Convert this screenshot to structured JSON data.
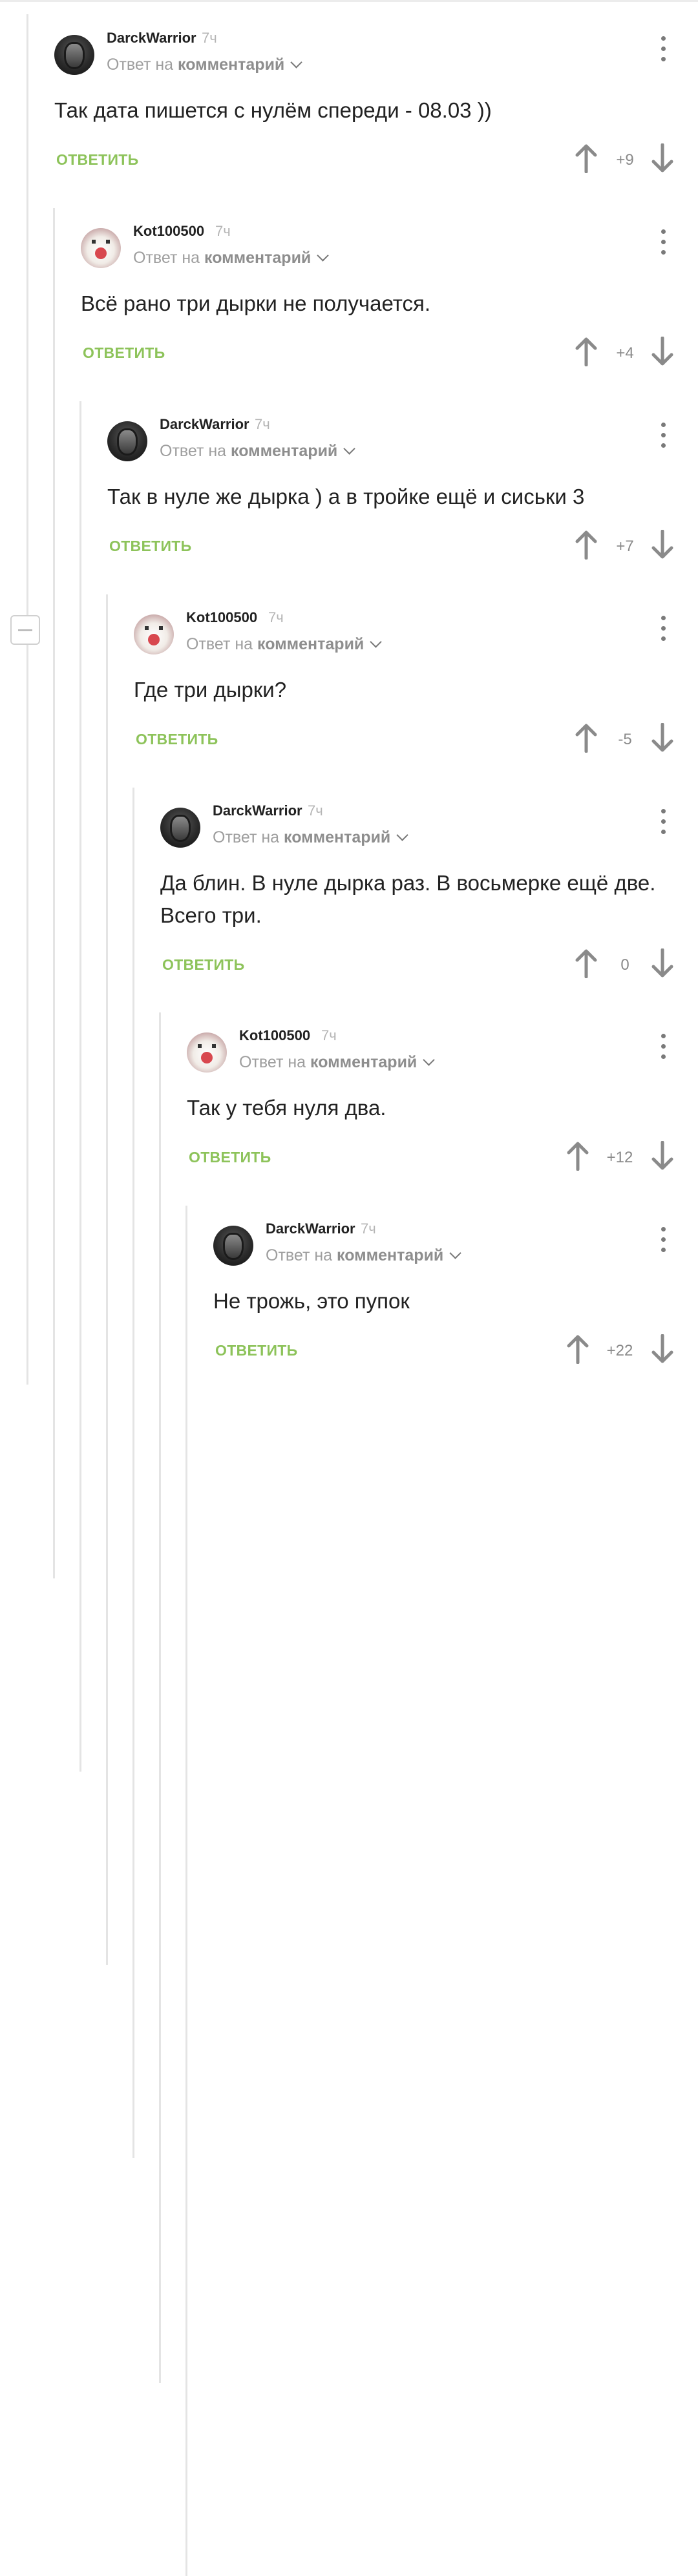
{
  "comments": [
    {
      "author": "DarckWarrior",
      "time": "7ч",
      "reply_prefix": "Ответ на",
      "reply_link": "комментарий",
      "text": "Так дата пишется с нулём спереди - 08.03 ))",
      "reply_label": "ОТВЕТИТЬ",
      "score": "+9",
      "avatar": "darckwarrior-avatar"
    },
    {
      "author": "Kot100500",
      "time": "7ч",
      "reply_prefix": "Ответ на",
      "reply_link": "комментарий",
      "text": "Всё рано три дырки не получается.",
      "reply_label": "ОТВЕТИТЬ",
      "score": "+4",
      "avatar": "kot100500-avatar"
    },
    {
      "author": "DarckWarrior",
      "time": "7ч",
      "reply_prefix": "Ответ на",
      "reply_link": "комментарий",
      "text": "Так в нуле же дырка ) а в тройке ещё и сиськи 3",
      "reply_label": "ОТВЕТИТЬ",
      "score": "+7",
      "avatar": "darckwarrior-avatar"
    },
    {
      "author": "Kot100500",
      "time": "7ч",
      "reply_prefix": "Ответ на",
      "reply_link": "комментарий",
      "text": "Где три дырки?",
      "reply_label": "ОТВЕТИТЬ",
      "score": "-5",
      "avatar": "kot100500-avatar"
    },
    {
      "author": "DarckWarrior",
      "time": "7ч",
      "reply_prefix": "Ответ на",
      "reply_link": "комментарий",
      "text": "Да блин. В нуле дырка раз. В восьмерке ещё две. Всего три.",
      "reply_label": "ОТВЕТИТЬ",
      "score": "0",
      "avatar": "darckwarrior-avatar"
    },
    {
      "author": "Kot100500",
      "time": "7ч",
      "reply_prefix": "Ответ на",
      "reply_link": "комментарий",
      "text": "Так у тебя нуля два.",
      "reply_label": "ОТВЕТИТЬ",
      "score": "+12",
      "avatar": "kot100500-avatar"
    },
    {
      "author": "DarckWarrior",
      "time": "7ч",
      "reply_prefix": "Ответ на",
      "reply_link": "комментарий",
      "text": "Не трожь, это пупок",
      "reply_label": "ОТВЕТИТЬ",
      "score": "+22",
      "avatar": "darckwarrior-avatar"
    }
  ],
  "icons": {
    "upvote": "arrow-up-icon",
    "downvote": "arrow-down-icon",
    "more": "more-vertical-icon",
    "collapse": "collapse-minus-icon",
    "dropdown": "chevron-down-icon"
  },
  "colors": {
    "reply": "#8dc35a",
    "text": "#222222",
    "muted": "#9e9e9e",
    "thread_line": "#e4e4e4"
  }
}
